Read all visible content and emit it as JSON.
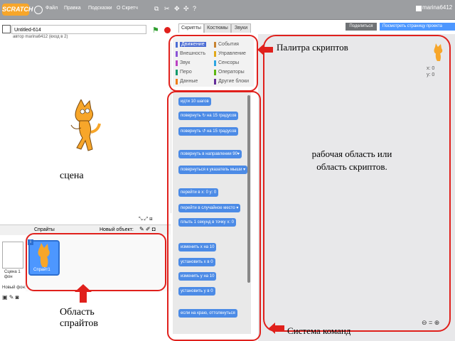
{
  "menubar": {
    "logo": "SCRATCH",
    "items": [
      "Файл",
      "Правка",
      "Подсказки",
      "О Скретч"
    ],
    "username": "marina6412"
  },
  "project": {
    "title": "Untitled-614",
    "subtitle": "автор marina6412 (вход в 2)"
  },
  "tabs": [
    "Скрипты",
    "Костюмы",
    "Звуки"
  ],
  "header_buttons": {
    "share": "Поделиться",
    "see_project": "Посмотреть страницу проекта"
  },
  "categories": [
    {
      "label": "Движение",
      "color": "#4a6cd4"
    },
    {
      "label": "События",
      "color": "#c88330"
    },
    {
      "label": "Внешность",
      "color": "#8a55d7"
    },
    {
      "label": "Управление",
      "color": "#e1a91a"
    },
    {
      "label": "Звук",
      "color": "#bb42c3"
    },
    {
      "label": "Сенсоры",
      "color": "#2ca5e2"
    },
    {
      "label": "Перо",
      "color": "#0e9a6c"
    },
    {
      "label": "Операторы",
      "color": "#5cb712"
    },
    {
      "label": "Данные",
      "color": "#ee7d16"
    },
    {
      "label": "Другие блоки",
      "color": "#632d99"
    }
  ],
  "blocks": [
    "идти 10 шагов",
    "повернуть ↻ на 15 градусов",
    "повернуть ↺ на 15 градусов",
    "повернуть в направлении 90▾",
    "повернуться к указатель мыши ▾",
    "перейти в x: 0 y: 0",
    "перейти в случайное место ▾",
    "плыть 1 секунд в точку x: 0",
    "изменить х на 10",
    "установить х в 0",
    "изменить у на 10",
    "установить у в 0",
    "если на краю, оттолкнуться"
  ],
  "stage": {
    "label": "сцена"
  },
  "sprites": {
    "header": "Спрайты",
    "new_sprite_label": "Новый объект:",
    "sprite_name": "Спрайт1",
    "badge": "i",
    "stage_thumb_label": "Сцена 1 фон",
    "new_backdrop_label": "Новый фон:"
  },
  "script_area": {
    "x_readout": "x: 0",
    "y_readout": "y: 0"
  },
  "annotations": {
    "palette": "Палитра скриптов",
    "script_area_line1": "рабочая область или",
    "script_area_line2": "область скриптов.",
    "stage": "сцена",
    "sprite_area_line1": "Область",
    "sprite_area_line2": "спрайтов",
    "command_system": "Система команд"
  },
  "colors": {
    "menubar": "#9c9ea1",
    "motion_block": "#4c8be6",
    "annotation": "#e0201c",
    "scratch_orange": "#f7a62a"
  }
}
